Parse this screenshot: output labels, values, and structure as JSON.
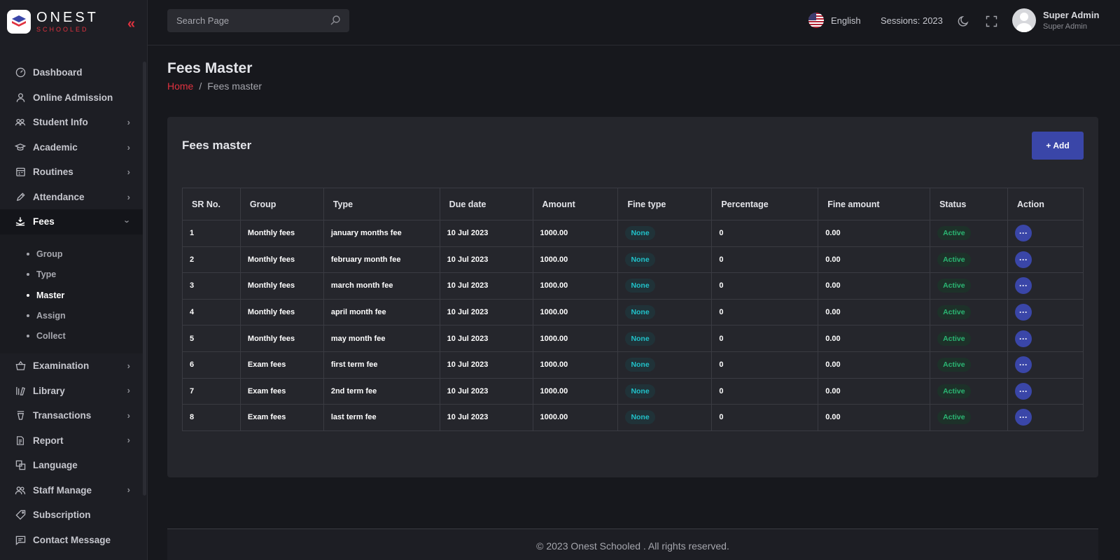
{
  "brand": {
    "name": "ONEST",
    "tagline": "SCHOOLED"
  },
  "search": {
    "placeholder": "Search Page"
  },
  "header": {
    "language": "English",
    "session": "Sessions: 2023",
    "user_name": "Super Admin",
    "user_role": "Super Admin"
  },
  "sidebar": {
    "items": [
      {
        "label": "Dashboard",
        "icon": "gauge-icon",
        "has_children": false
      },
      {
        "label": "Online Admission",
        "icon": "user-icon",
        "has_children": false
      },
      {
        "label": "Student Info",
        "icon": "users-icon",
        "has_children": true
      },
      {
        "label": "Academic",
        "icon": "graduation-cap-icon",
        "has_children": true
      },
      {
        "label": "Routines",
        "icon": "calendar-icon",
        "has_children": true
      },
      {
        "label": "Attendance",
        "icon": "pen-icon",
        "has_children": true
      },
      {
        "label": "Fees",
        "icon": "fees-icon",
        "has_children": true,
        "expanded": true
      }
    ],
    "fees_sub": [
      "Group",
      "Type",
      "Master",
      "Assign",
      "Collect"
    ],
    "active_sub": "Master",
    "items_after": [
      {
        "label": "Examination",
        "icon": "basket-icon",
        "has_children": true
      },
      {
        "label": "Library",
        "icon": "library-icon",
        "has_children": true
      },
      {
        "label": "Transactions",
        "icon": "transactions-icon",
        "has_children": true
      },
      {
        "label": "Report",
        "icon": "report-icon",
        "has_children": true
      },
      {
        "label": "Language",
        "icon": "language-icon",
        "has_children": false
      },
      {
        "label": "Staff Manage",
        "icon": "staff-icon",
        "has_children": true
      },
      {
        "label": "Subscription",
        "icon": "tag-icon",
        "has_children": false
      },
      {
        "label": "Contact Message",
        "icon": "message-icon",
        "has_children": false
      }
    ]
  },
  "page": {
    "title": "Fees Master",
    "breadcrumb_home": "Home",
    "breadcrumb_sep": "/",
    "breadcrumb_current": "Fees master"
  },
  "card": {
    "title": "Fees master",
    "add_label": "Add"
  },
  "table": {
    "headers": [
      "SR No.",
      "Group",
      "Type",
      "Due date",
      "Amount",
      "Fine type",
      "Percentage",
      "Fine amount",
      "Status",
      "Action"
    ],
    "rows": [
      {
        "sr": "1",
        "group": "Monthly fees",
        "type": "january months fee",
        "due": "10 Jul 2023",
        "amount": "1000.00",
        "fine_type": "None",
        "percentage": "0",
        "fine_amount": "0.00",
        "status": "Active"
      },
      {
        "sr": "2",
        "group": "Monthly fees",
        "type": "february month fee",
        "due": "10 Jul 2023",
        "amount": "1000.00",
        "fine_type": "None",
        "percentage": "0",
        "fine_amount": "0.00",
        "status": "Active"
      },
      {
        "sr": "3",
        "group": "Monthly fees",
        "type": "march month fee",
        "due": "10 Jul 2023",
        "amount": "1000.00",
        "fine_type": "None",
        "percentage": "0",
        "fine_amount": "0.00",
        "status": "Active"
      },
      {
        "sr": "4",
        "group": "Monthly fees",
        "type": "april month fee",
        "due": "10 Jul 2023",
        "amount": "1000.00",
        "fine_type": "None",
        "percentage": "0",
        "fine_amount": "0.00",
        "status": "Active"
      },
      {
        "sr": "5",
        "group": "Monthly fees",
        "type": "may month fee",
        "due": "10 Jul 2023",
        "amount": "1000.00",
        "fine_type": "None",
        "percentage": "0",
        "fine_amount": "0.00",
        "status": "Active"
      },
      {
        "sr": "6",
        "group": "Exam fees",
        "type": "first term fee",
        "due": "10 Jul 2023",
        "amount": "1000.00",
        "fine_type": "None",
        "percentage": "0",
        "fine_amount": "0.00",
        "status": "Active"
      },
      {
        "sr": "7",
        "group": "Exam fees",
        "type": "2nd term fee",
        "due": "10 Jul 2023",
        "amount": "1000.00",
        "fine_type": "None",
        "percentage": "0",
        "fine_amount": "0.00",
        "status": "Active"
      },
      {
        "sr": "8",
        "group": "Exam fees",
        "type": "last term fee",
        "due": "10 Jul 2023",
        "amount": "1000.00",
        "fine_type": "None",
        "percentage": "0",
        "fine_amount": "0.00",
        "status": "Active"
      }
    ]
  },
  "footer": {
    "text": "© 2023 Onest Schooled . All rights reserved."
  },
  "colors": {
    "accent": "#e0323f",
    "primary_button": "#3a46a8",
    "status_active": "#2bb673",
    "fine_none": "#21c1c9"
  }
}
